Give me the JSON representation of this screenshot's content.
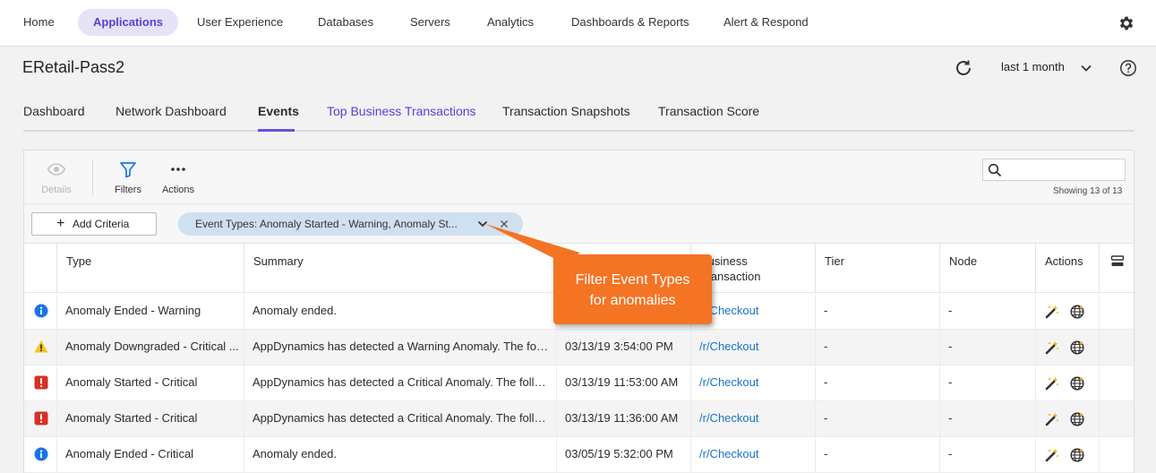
{
  "nav": {
    "items": [
      {
        "label": "Home"
      },
      {
        "label": "Applications"
      },
      {
        "label": "User Experience"
      },
      {
        "label": "Databases"
      },
      {
        "label": "Servers"
      },
      {
        "label": "Analytics"
      },
      {
        "label": "Dashboards & Reports"
      },
      {
        "label": "Alert & Respond"
      }
    ],
    "active": "Applications"
  },
  "header": {
    "title": "ERetail-Pass2",
    "time_range": "last 1 month"
  },
  "tabs": [
    {
      "label": "Dashboard"
    },
    {
      "label": "Network Dashboard"
    },
    {
      "label": "Events"
    },
    {
      "label": "Top Business Transactions"
    },
    {
      "label": "Transaction Snapshots"
    },
    {
      "label": "Transaction Score"
    }
  ],
  "active_tab": "Events",
  "toolbar": {
    "details_label": "Details",
    "filters_label": "Filters",
    "actions_label": "Actions",
    "search_value": "",
    "showing_text": "Showing 13 of 13"
  },
  "criteria": {
    "add_label": "Add Criteria",
    "chip_label": "Event Types: Anomaly Started - Warning, Anomaly St..."
  },
  "table": {
    "columns": {
      "type": "Type",
      "summary": "Summary",
      "time": "",
      "business_transaction": "Business\nTransaction",
      "tier": "Tier",
      "node": "Node",
      "actions": "Actions"
    },
    "rows": [
      {
        "severity": "info",
        "type": "Anomaly Ended - Warning",
        "summary": "Anomaly ended.",
        "time": "",
        "bt": "/r/Checkout",
        "tier": "-",
        "node": "-"
      },
      {
        "severity": "warning",
        "type": "Anomaly Downgraded - Critical ...",
        "summary": "AppDynamics has detected a Warning Anomaly. The follo...",
        "time": "03/13/19 3:54:00 PM",
        "bt": "/r/Checkout",
        "tier": "-",
        "node": "-"
      },
      {
        "severity": "critical",
        "type": "Anomaly Started - Critical",
        "summary": "AppDynamics has detected a Critical Anomaly. The follow...",
        "time": "03/13/19 11:53:00 AM",
        "bt": "/r/Checkout",
        "tier": "-",
        "node": "-"
      },
      {
        "severity": "critical",
        "type": "Anomaly Started - Critical",
        "summary": "AppDynamics has detected a Critical Anomaly. The follow...",
        "time": "03/13/19 11:36:00 AM",
        "bt": "/r/Checkout",
        "tier": "-",
        "node": "-"
      },
      {
        "severity": "info",
        "type": "Anomaly Ended - Critical",
        "summary": "Anomaly ended.",
        "time": "03/05/19 5:32:00 PM",
        "bt": "/r/Checkout",
        "tier": "-",
        "node": "-"
      }
    ]
  },
  "callout": {
    "line1": "Filter Event Types",
    "line2": "for anomalies"
  },
  "colors": {
    "accent": "#5a3fd6",
    "link": "#1a73c8",
    "info": "#1a73e8",
    "warning": "#f5c518",
    "critical": "#d93025",
    "callout": "#f47424"
  }
}
